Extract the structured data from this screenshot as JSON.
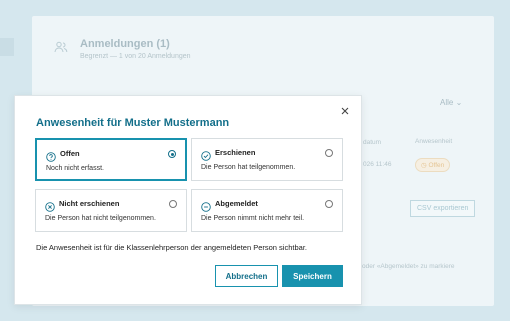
{
  "background": {
    "title": "Anmeldungen (1)",
    "subtitle": "Begrenzt — 1 von 20 Anmeldungen",
    "filter_label": "Alle",
    "columns": {
      "datum": "datum",
      "anwesenheit": "Anwesenheit"
    },
    "row": {
      "time": "026 11:46",
      "status": "Offen"
    },
    "csv_button": "CSV exportieren",
    "hint": "oder «Abgemeldet» zu markiere"
  },
  "modal": {
    "title": "Anwesenheit für Muster Mustermann",
    "options": [
      {
        "label": "Offen",
        "description": "Noch nicht erfasst.",
        "selected": true,
        "icon": "question-circle-icon"
      },
      {
        "label": "Erschienen",
        "description": "Die Person hat teilgenommen.",
        "selected": false,
        "icon": "check-circle-icon"
      },
      {
        "label": "Nicht erschienen",
        "description": "Die Person hat nicht teilgenommen.",
        "selected": false,
        "icon": "x-circle-icon"
      },
      {
        "label": "Abgemeldet",
        "description": "Die Person nimmt nicht mehr teil.",
        "selected": false,
        "icon": "minus-circle-icon"
      }
    ],
    "note": "Die Anwesenheit ist für die Klassenlehrperson der angemeldeten Person sichtbar.",
    "cancel_label": "Abbrechen",
    "save_label": "Speichern"
  },
  "colors": {
    "accent": "#1892ae",
    "title": "#136f8a",
    "backdrop": "#d5e7ee"
  }
}
